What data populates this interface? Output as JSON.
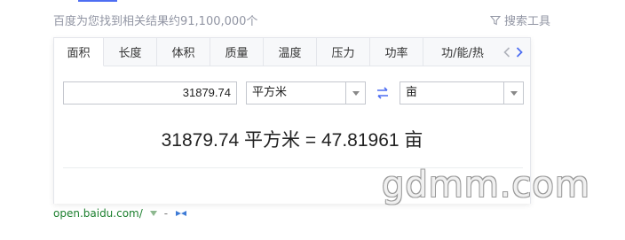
{
  "result_count": "百度为您找到相关结果约91,100,000个",
  "search_tools": {
    "label": "搜索工具",
    "icon": "filter-icon"
  },
  "tabs": [
    {
      "label": "面积",
      "active": true
    },
    {
      "label": "长度",
      "active": false
    },
    {
      "label": "体积",
      "active": false
    },
    {
      "label": "质量",
      "active": false
    },
    {
      "label": "温度",
      "active": false
    },
    {
      "label": "压力",
      "active": false
    },
    {
      "label": "功率",
      "active": false
    },
    {
      "label": "功/能/热",
      "active": false
    }
  ],
  "converter": {
    "input_value": "31879.74",
    "from_unit": "平方米",
    "to_unit": "亩",
    "result_text": "31879.74 平方米 = 47.81961 亩"
  },
  "source": {
    "url": "open.baidu.com/",
    "separator": "-"
  },
  "watermark": "gdmm.com",
  "colors": {
    "accent": "#4e6ef2",
    "source_green": "#1b7f2d",
    "muted": "#9195a3"
  }
}
